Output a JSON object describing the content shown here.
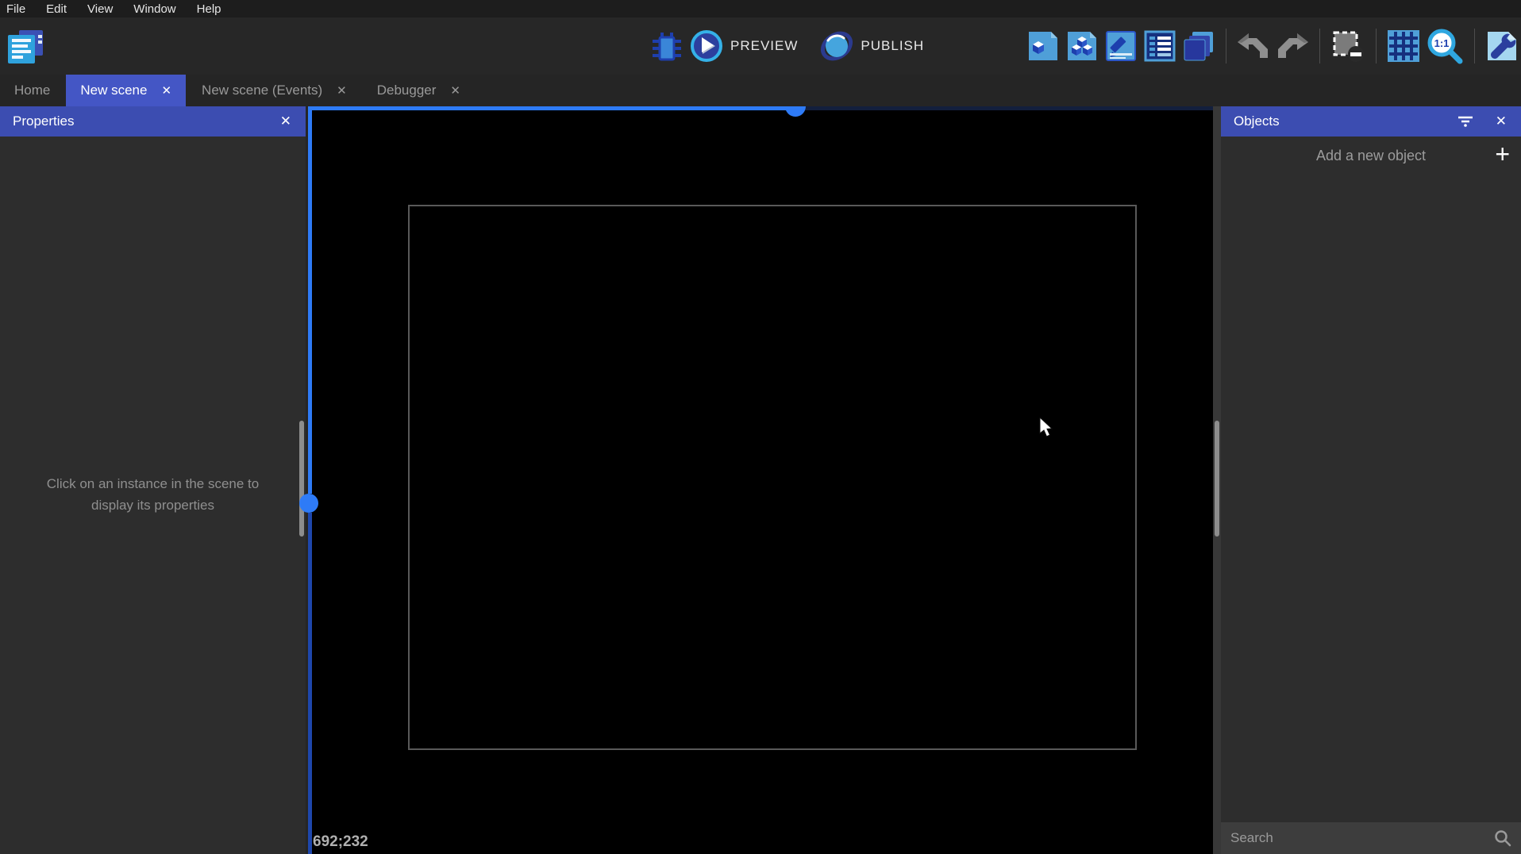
{
  "menu": {
    "items": [
      "File",
      "Edit",
      "View",
      "Window",
      "Help"
    ]
  },
  "toolbar": {
    "preview_label": "PREVIEW",
    "publish_label": "PUBLISH",
    "icon_names": [
      "project-manager",
      "debug",
      "preview-play",
      "publish-globe",
      "open-objects-panel",
      "open-object-groups-panel",
      "open-properties-panel",
      "open-instances-list-panel",
      "open-layers-panel",
      "undo",
      "redo",
      "deselect-mask",
      "toggle-grid",
      "zoom-1-1",
      "open-scene-properties"
    ]
  },
  "tabs": [
    {
      "label": "Home",
      "active": false,
      "closable": false
    },
    {
      "label": "New scene",
      "active": true,
      "closable": true
    },
    {
      "label": "New scene (Events)",
      "active": false,
      "closable": true
    },
    {
      "label": "Debugger",
      "active": false,
      "closable": true
    }
  ],
  "properties_panel": {
    "title": "Properties",
    "empty_message": "Click on an instance in the scene to display its properties"
  },
  "scene_canvas": {
    "cursor_coordinates": "692;232"
  },
  "objects_panel": {
    "title": "Objects",
    "add_button_label": "Add a new object",
    "search_placeholder": "Search"
  },
  "glyphs": {
    "close": "✕",
    "plus": "+"
  },
  "colors": {
    "accent_blue": "#2e7bf7",
    "panel_header": "#3c4db1",
    "active_tab": "#4456c5",
    "canvas_bg": "#000000",
    "panel_bg": "#2d2d2d"
  }
}
